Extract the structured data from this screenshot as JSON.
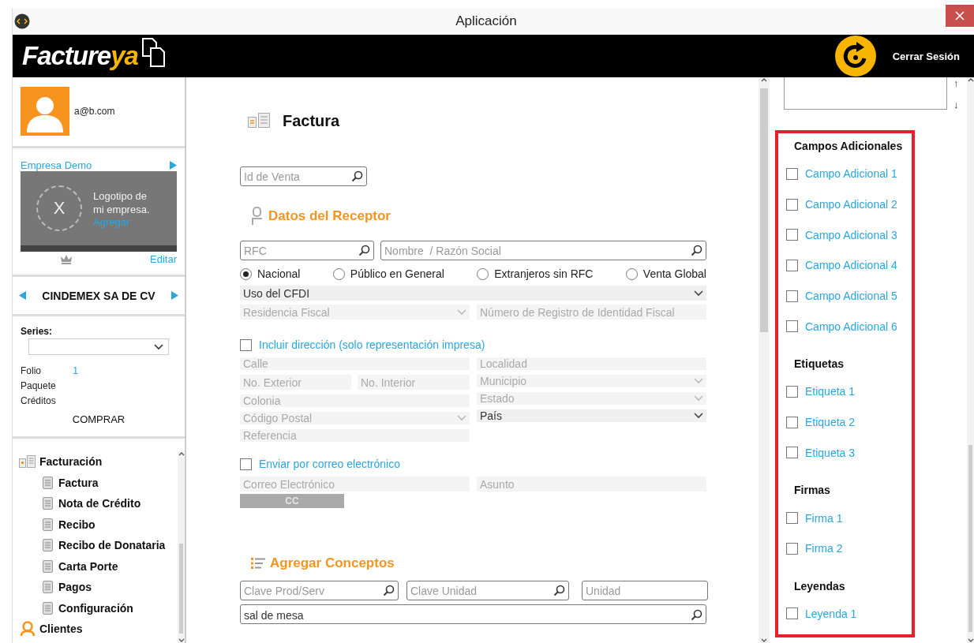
{
  "window": {
    "title": "Aplicación"
  },
  "header": {
    "logo_main": "Facture",
    "logo_accent": "ya",
    "logout": "Cerrar Sesión"
  },
  "profile": {
    "email": "a@b.com"
  },
  "company": {
    "name": "Empresa Demo",
    "logo_mark": "X",
    "logo_text": "Logotipo de mi empresa.",
    "logo_link": "Agregar",
    "edit": "Editar"
  },
  "switcher": {
    "name": "CINDEMEX SA DE CV"
  },
  "series": {
    "label": "Series:",
    "stats": [
      {
        "label": "Folio",
        "value": "1"
      },
      {
        "label": "Paquete"
      },
      {
        "label": "Créditos"
      }
    ],
    "buy": "COMPRAR"
  },
  "nav": [
    {
      "label": "Facturación",
      "kind": "group",
      "children": [
        {
          "label": "Factura"
        },
        {
          "label": "Nota de Crédito"
        },
        {
          "label": "Recibo"
        },
        {
          "label": "Recibo de Donataria"
        },
        {
          "label": "Carta Porte"
        },
        {
          "label": "Pagos"
        },
        {
          "label": "Configuración"
        }
      ]
    },
    {
      "label": "Clientes",
      "kind": "person"
    }
  ],
  "form": {
    "title": "Factura",
    "sale_id": {
      "placeholder": "Id de Venta"
    },
    "receptor": {
      "title": "Datos del Receptor",
      "rfc": {
        "placeholder": "RFC"
      },
      "name": {
        "placeholder": "Nombre  / Razón Social"
      },
      "types": [
        {
          "label": "Nacional",
          "selected": true
        },
        {
          "label": "Público en General",
          "selected": false
        },
        {
          "label": "Extranjeros sin RFC",
          "selected": false
        },
        {
          "label": "Venta Global",
          "selected": false
        }
      ],
      "uso_cfdi": {
        "value": "Uso del CFDI",
        "kind": "select",
        "disabled": false
      },
      "residencia": {
        "placeholder": "Residencia Fiscal",
        "kind": "select",
        "disabled": true
      },
      "registro": {
        "placeholder": "Número de Registro de Identidad Fiscal",
        "kind": "input",
        "disabled": true
      }
    },
    "address": {
      "label": "Incluir dirección (solo representación impresa)",
      "checked": false,
      "left": [
        {
          "placeholder": "Calle",
          "kind": "input",
          "disabled": true
        },
        {
          "placeholder": "No. Exterior",
          "kind": "pair",
          "disabled": true,
          "second": "No. Interior"
        },
        {
          "placeholder": "Colonia",
          "kind": "input",
          "disabled": true
        },
        {
          "placeholder": "Código Postal",
          "kind": "select",
          "disabled": true
        },
        {
          "placeholder": "Referencia",
          "kind": "input",
          "disabled": true
        }
      ],
      "right": [
        {
          "placeholder": "Localidad",
          "kind": "input",
          "disabled": true
        },
        {
          "placeholder": "Municipio",
          "kind": "select",
          "disabled": true
        },
        {
          "placeholder": "Estado",
          "kind": "select",
          "disabled": true
        },
        {
          "value": "País",
          "kind": "select",
          "disabled": false
        }
      ]
    },
    "email": {
      "label": "Enviar por correo electrónico",
      "checked": false,
      "address": {
        "placeholder": "Correo Electrónico"
      },
      "subject": {
        "placeholder": "Asunto"
      },
      "cc": {
        "label": "CC",
        "disabled": true
      }
    },
    "concepts": {
      "title": "Agregar Conceptos",
      "fields": [
        {
          "placeholder": "Clave Prod/Serv",
          "search": true
        },
        {
          "placeholder": "Clave Unidad",
          "search": true
        },
        {
          "placeholder": "Unidad",
          "search": false
        }
      ],
      "description": {
        "value": "sal de mesa"
      }
    }
  },
  "extras": {
    "arrows": [
      "↑",
      "↓"
    ],
    "groups": [
      {
        "title": "Campos Adicionales",
        "items": [
          {
            "label": "Campo Adicional 1",
            "checked": false
          },
          {
            "label": "Campo Adicional 2",
            "checked": false
          },
          {
            "label": "Campo Adicional 3",
            "checked": false
          },
          {
            "label": "Campo Adicional 4",
            "checked": false
          },
          {
            "label": "Campo Adicional 5",
            "checked": false
          },
          {
            "label": "Campo Adicional 6",
            "checked": false
          }
        ]
      },
      {
        "title": "Etiquetas",
        "items": [
          {
            "label": "Etiqueta 1",
            "checked": false
          },
          {
            "label": "Etiqueta 2",
            "checked": false
          },
          {
            "label": "Etiqueta 3",
            "checked": false
          }
        ]
      },
      {
        "title": "Firmas",
        "items": [
          {
            "label": "Firma 1",
            "checked": false
          },
          {
            "label": "Firma 2",
            "checked": false
          }
        ]
      },
      {
        "title": "Leyendas",
        "items": [
          {
            "label": "Leyenda 1",
            "checked": false
          }
        ]
      }
    ]
  }
}
